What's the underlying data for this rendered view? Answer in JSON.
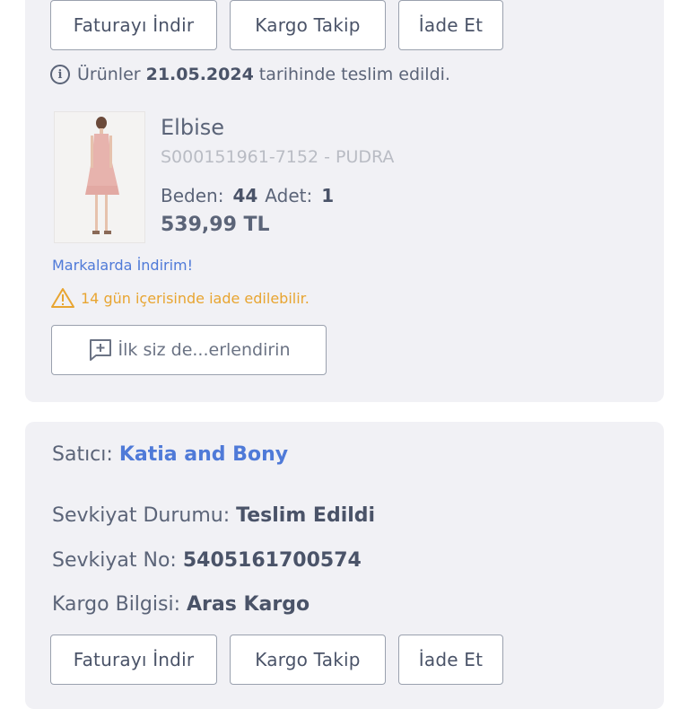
{
  "order_card_1": {
    "buttons": {
      "invoice": "Faturayı İndir",
      "tracking": "Kargo Takip",
      "return": "İade Et"
    },
    "delivery": {
      "prefix": "Ürünler",
      "date": "21.05.2024",
      "suffix": "tarihinde teslim edildi.",
      "icon": "info-icon"
    },
    "product": {
      "name": "Elbise",
      "code": "S000151961-7152 - PUDRA",
      "size_label": "Beden:",
      "size_value": "44",
      "qty_label": "Adet:",
      "qty_value": "1",
      "price": "539,99 TL"
    },
    "campaign_link": "Markalarda İndirim!",
    "return_note": {
      "text": "14 gün içerisinde iade edilebilir.",
      "icon": "warning-icon",
      "color": "#e8a531"
    },
    "review_button": {
      "label": "İlk siz de...erlendirin",
      "icon": "add-comment-icon"
    }
  },
  "order_card_2": {
    "seller_label": "Satıcı:",
    "seller_name": "Katia and Bony",
    "shipment_status_label": "Sevkiyat Durumu:",
    "shipment_status_value": "Teslim Edildi",
    "shipment_no_label": "Sevkiyat No:",
    "shipment_no_value": "5405161700574",
    "cargo_label": "Kargo Bilgisi:",
    "cargo_value": "Aras Kargo",
    "buttons": {
      "invoice": "Faturayı İndir",
      "tracking": "Kargo Takip",
      "return": "İade Et"
    }
  },
  "colors": {
    "accent": "#4f7ad8",
    "warning": "#e8a531",
    "card_bg": "#f1f1f5",
    "text": "#5b6478"
  }
}
